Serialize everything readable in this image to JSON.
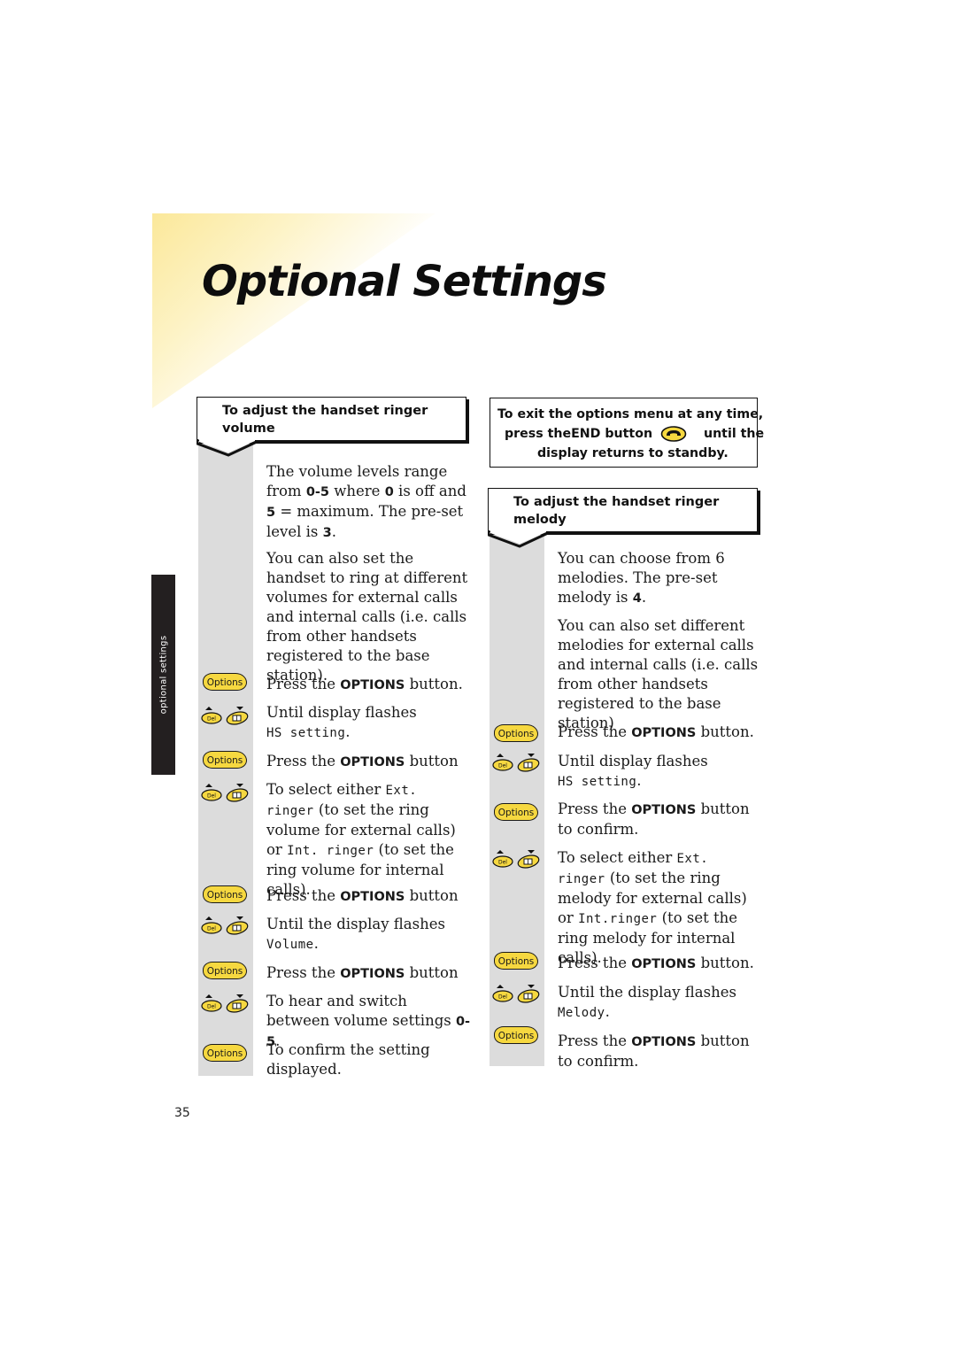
{
  "page": {
    "title": "Optional Settings",
    "side_tab": "optional settings",
    "page_number": "35",
    "accent_color": "#f6d840",
    "tab_color": "#231f20"
  },
  "volume_section": {
    "heading": "To adjust the handset ringer volume",
    "intro": [
      {
        "parts": [
          "The volume levels range from ",
          "0-5",
          " where ",
          "0",
          " is off and ",
          "5",
          " = maximum. The pre-set level is ",
          "3",
          "."
        ]
      },
      {
        "text": "You can also set the handset to ring at different volumes for external calls and internal calls (i.e. calls from other handsets registered to the base station)."
      }
    ],
    "steps": [
      {
        "icon": "options-button",
        "icon_label": "Options",
        "text": "Press the ",
        "bold": "OPTIONS",
        "after": " button."
      },
      {
        "icon": "del-nav-buttons",
        "icon_label": "Del",
        "text": "Until display flashes",
        "lcd": "HS setting",
        "after": "."
      },
      {
        "icon": "options-button",
        "icon_label": "Options",
        "text": "Press the ",
        "bold": "OPTIONS",
        "after": " button"
      },
      {
        "icon": "del-nav-buttons",
        "icon_label": "Del",
        "text": "To select either ",
        "lcd1": "Ext. ringer",
        "mid1": " (to set the ring volume for external calls) or ",
        "lcd2": "Int. ringer",
        "mid2": " (to set the ring volume for internal calls)."
      },
      {
        "icon": "options-button",
        "icon_label": "Options",
        "text": "Press the ",
        "bold": "OPTIONS",
        "after": " button"
      },
      {
        "icon": "del-nav-buttons",
        "icon_label": "Del",
        "text": "Until the display flashes",
        "lcd": "Volume",
        "after": "."
      },
      {
        "icon": "options-button",
        "icon_label": "Options",
        "text": "Press the ",
        "bold": "OPTIONS",
        "after": " button"
      },
      {
        "icon": "del-nav-buttons",
        "icon_label": "Del",
        "text": "To hear and switch between volume settings ",
        "bold": "0-5",
        "after": "."
      },
      {
        "icon": "options-button",
        "icon_label": "Options",
        "text": "To confirm the setting displayed."
      }
    ]
  },
  "exit_note": {
    "line1": "To exit the options menu at any time,",
    "line2_a": "press the",
    "line2_bold": "END",
    "line2_b": " button",
    "line2_c": "until the",
    "line3": "display returns to standby.",
    "icon": "end-call-icon"
  },
  "melody_section": {
    "heading": "To adjust the handset ringer melody",
    "intro": [
      {
        "parts": [
          "You can choose from 6 melodies. The pre-set melody is ",
          "4",
          "."
        ]
      },
      {
        "text": "You can also set different melodies for external calls and internal calls (i.e. calls from other handsets registered to the base station)"
      }
    ],
    "steps": [
      {
        "icon": "options-button",
        "icon_label": "Options",
        "text": "Press the ",
        "bold": "OPTIONS",
        "after": " button."
      },
      {
        "icon": "del-nav-buttons",
        "icon_label": "Del",
        "text": "Until display flashes",
        "lcd": "HS setting",
        "after": "."
      },
      {
        "icon": "options-button",
        "icon_label": "Options",
        "text": "Press the ",
        "bold": "OPTIONS",
        "after": " button to confirm."
      },
      {
        "icon": "del-nav-buttons",
        "icon_label": "Del",
        "text": "To select either ",
        "lcd1": "Ext. ringer",
        "mid1": " (to set the ring melody for external calls) or ",
        "lcd2": "Int.ringer",
        "mid2": " (to set the ring melody for internal calls)."
      },
      {
        "icon": "options-button",
        "icon_label": "Options",
        "text": "Press the ",
        "bold": "OPTIONS",
        "after": " button."
      },
      {
        "icon": "del-nav-buttons",
        "icon_label": "Del",
        "text": "Until the display flashes",
        "lcd": "Melody",
        "after": "."
      },
      {
        "icon": "options-button",
        "icon_label": "Options",
        "text": "Press the ",
        "bold": "OPTIONS",
        "after": " button to confirm."
      }
    ]
  }
}
